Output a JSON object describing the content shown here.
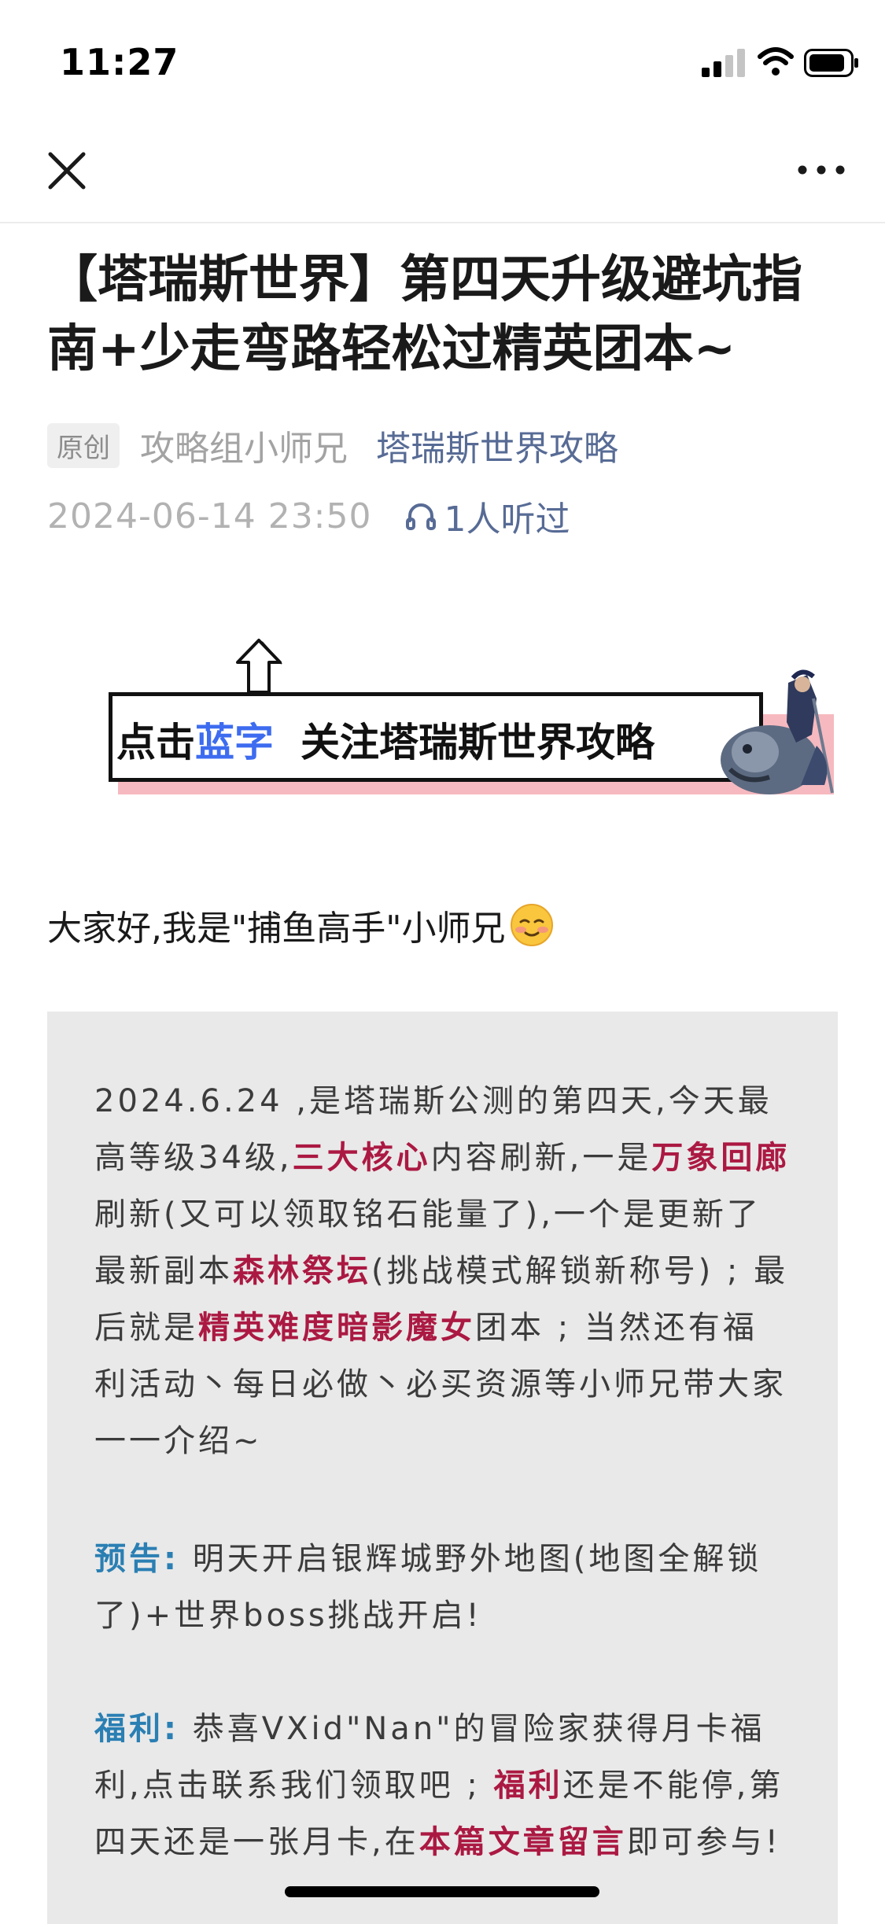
{
  "status_bar": {
    "time": "11:27"
  },
  "article": {
    "title": "【塔瑞斯世界】第四天升级避坑指南+少走弯路轻松过精英团本~",
    "badge": "原创",
    "author": "攻略组小师兄",
    "account": "塔瑞斯世界攻略",
    "date": "2024-06-14 23:50",
    "listens": "1人听过"
  },
  "banner": {
    "text_prefix": "点击",
    "text_blue": "蓝字",
    "text_suffix": "关注塔瑞斯世界攻略"
  },
  "greeting": "大家好,我是\"捕鱼高手\"小师兄",
  "paragraphs": {
    "p1": {
      "t1": "2024.6.24 ,是塔瑞斯公测的第四天,今天最高等级34级,",
      "h1": "三大核心",
      "t2": "内容刷新,一是",
      "h2": "万象回廊",
      "t3": "刷新(又可以领取铭石能量了),一个是更新了最新副本",
      "h3": "森林祭坛",
      "t4": "(挑战模式解锁新称号) ; 最后就是",
      "h4": "精英难度暗影魔女",
      "t5": "团本 ; 当然还有福利活动丶每日必做丶必买资源等小师兄带大家一一介绍~"
    },
    "p2": {
      "label": "预告:",
      "text": " 明天开启银辉城野外地图(地图全解锁了)+世界boss挑战开启!"
    },
    "p3": {
      "label": "福利:",
      "t1": " 恭喜VXid\"Nan\"的冒险家获得月卡福利,点击联系我们领取吧 ; ",
      "h1": "福利",
      "t2": "还是不能停,第四天还是一张月卡,在",
      "h2": "本篇文章留言",
      "t3": "即可参与!"
    }
  },
  "colors": {
    "highlight_red": "#ab1942",
    "label_blue": "#2a7fb3",
    "link_blue": "#576b95",
    "banner_blue": "#3d6cf0",
    "content_bg": "#e9e9e9"
  },
  "icons": [
    "signal-icon",
    "wifi-icon",
    "battery-icon",
    "close-icon",
    "more-icon",
    "headphone-icon",
    "arrow-up-icon",
    "knight-illustration",
    "smile-emoji"
  ]
}
